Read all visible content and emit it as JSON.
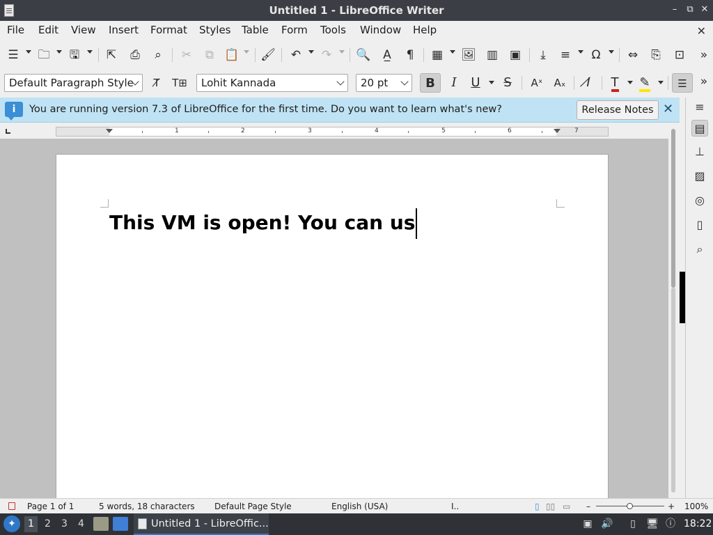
{
  "window": {
    "title": "Untitled 1 - LibreOffice Writer",
    "controls": [
      "–",
      "⧉",
      "✕"
    ]
  },
  "menubar": {
    "items": [
      "File",
      "Edit",
      "View",
      "Insert",
      "Format",
      "Styles",
      "Table",
      "Form",
      "Tools",
      "Window",
      "Help"
    ],
    "close_doc": "✕"
  },
  "format_bar": {
    "paragraph_style": "Default Paragraph Style",
    "font_name": "Lohit Kannada",
    "font_size": "20 pt",
    "bold": "B",
    "italic": "I",
    "underline": "U",
    "strikethrough": "S"
  },
  "infobar": {
    "message": "You are running version 7.3 of LibreOffice for the first time. Do you want to learn what's new?",
    "button": "Release Notes"
  },
  "ruler": {
    "labels": [
      "1",
      "2",
      "3",
      "4",
      "5",
      "6",
      "7"
    ]
  },
  "document": {
    "text": "This VM is open! You can us"
  },
  "statusbar": {
    "page": "Page 1 of 1",
    "word_count": "5 words, 18 characters",
    "page_style": "Default Page Style",
    "language": "English (USA)",
    "zoom": "100%"
  },
  "taskbar": {
    "workspaces": [
      "1",
      "2",
      "3",
      "4"
    ],
    "active_task": "Untitled 1 - LibreOffic...",
    "clock": "18:22"
  },
  "colors": {
    "titlebar": "#3b3f45",
    "infobar": "#bfe3f4",
    "taskbar": "#2e3237",
    "accent": "#2f78c8"
  }
}
